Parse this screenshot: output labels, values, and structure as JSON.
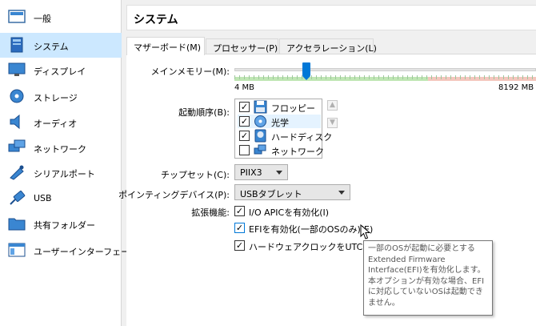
{
  "sidebar": {
    "items": [
      {
        "label": "一般",
        "icon": "general-icon"
      },
      {
        "label": "システム",
        "icon": "system-icon",
        "selected": true
      },
      {
        "label": "ディスプレイ",
        "icon": "display-icon"
      },
      {
        "label": "ストレージ",
        "icon": "storage-icon"
      },
      {
        "label": "オーディオ",
        "icon": "audio-icon"
      },
      {
        "label": "ネットワーク",
        "icon": "network-icon"
      },
      {
        "label": "シリアルポート",
        "icon": "serial-port-icon"
      },
      {
        "label": "USB",
        "icon": "usb-icon"
      },
      {
        "label": "共有フォルダー",
        "icon": "shared-folder-icon"
      },
      {
        "label": "ユーザーインターフェース",
        "icon": "user-interface-icon"
      }
    ]
  },
  "header": {
    "title": "システム"
  },
  "tabs": [
    {
      "label": "マザーボード(M)",
      "active": true
    },
    {
      "label": "プロセッサー(P)"
    },
    {
      "label": "アクセラレーション(L)"
    }
  ],
  "motherboard": {
    "memory_label": "メインメモリー(M):",
    "memory_min": "4 MB",
    "memory_max": "8192 MB",
    "memory_fraction": 0.24,
    "boot_order_label": "起動順序(B):",
    "boot_items": [
      {
        "label": "フロッピー",
        "checked": true,
        "icon": "floppy-icon"
      },
      {
        "label": "光学",
        "checked": true,
        "icon": "optical-disc-icon"
      },
      {
        "label": "ハードディスク",
        "checked": true,
        "icon": "hard-disk-icon"
      },
      {
        "label": "ネットワーク",
        "checked": false,
        "icon": "network-boot-icon"
      }
    ],
    "chipset_label": "チップセット(C):",
    "chipset_value": "PIIX3",
    "pointing_label": "ポインティングデバイス(P):",
    "pointing_value": "USBタブレット",
    "features_label": "拡張機能:",
    "features": [
      {
        "label": "I/O APICを有効化(I)",
        "checked": true
      },
      {
        "label": "EFIを有効化(一部のOSのみ)(E)",
        "checked": true
      },
      {
        "label": "ハードウェアクロックをUTCにする",
        "checked": true
      }
    ]
  },
  "tooltip": {
    "lines": [
      "一部のOSが起動に必要とする",
      "Extended Firmware",
      "Interface(EFI)を有効化します。",
      "本オプションが有効な場合、EFI",
      "に対応していないOSは起動でき",
      "ません。"
    ]
  },
  "colors": {
    "accent": "#0078d7",
    "selected_bg": "#cce8ff",
    "tooltip_text": "#575757"
  }
}
